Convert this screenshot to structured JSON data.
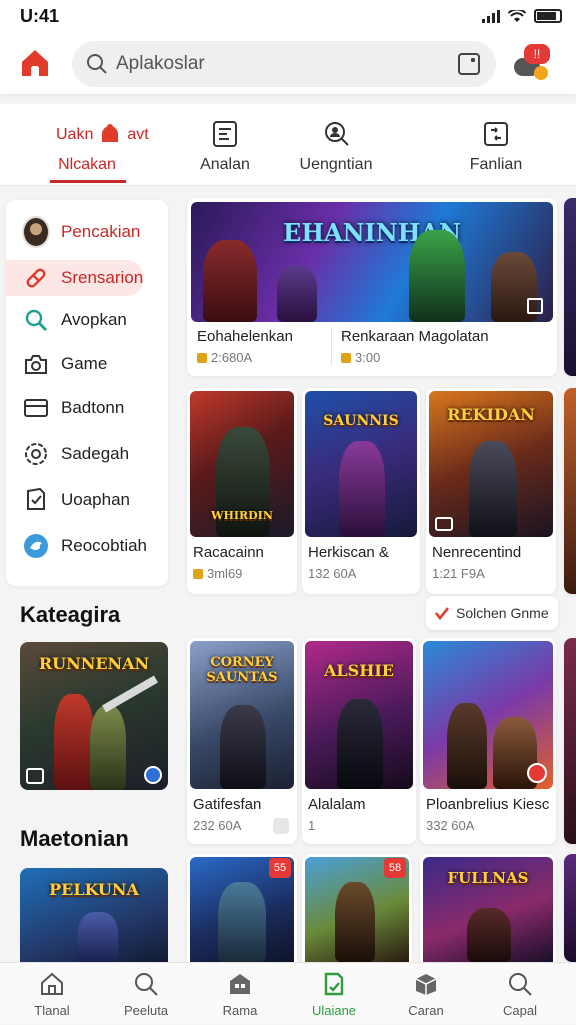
{
  "status": {
    "time": "U:41"
  },
  "search": {
    "placeholder": "Aplakoslar"
  },
  "notification": {
    "badge": "!!"
  },
  "tabs": [
    {
      "label": "Nlcakan",
      "top_label": "Uakn",
      "top_suffix": "avt",
      "active": true
    },
    {
      "label": "Analan"
    },
    {
      "label": "Uengntian"
    },
    {
      "label": "Fanlian"
    }
  ],
  "sidebar": {
    "items": [
      {
        "label": "Pencakian",
        "icon": "avatar"
      },
      {
        "label": "Srensarion",
        "icon": "pill-icon"
      },
      {
        "label": "Avopkan",
        "icon": "search-icon"
      },
      {
        "label": "Game",
        "icon": "camera-icon"
      },
      {
        "label": "Badtonn",
        "icon": "card-icon"
      },
      {
        "label": "Sadegah",
        "icon": "gear-chat-icon"
      },
      {
        "label": "Uoaphan",
        "icon": "check-shield-icon"
      },
      {
        "label": "Reocobtiah",
        "icon": "blue-bird-icon"
      }
    ]
  },
  "sections": {
    "kategori": "Kateagira",
    "mae": "Maetonian"
  },
  "side_cards": [
    {
      "title": "RUNNENAN"
    },
    {
      "title": "PELKUNA"
    }
  ],
  "featured": [
    {
      "title": "EHANINHAN",
      "name": "Eohahelenkan",
      "meta": "2:680A"
    },
    {
      "title": "",
      "name": "Renkaraan  Magolatan",
      "meta": "3:00"
    }
  ],
  "row1": [
    {
      "title": "WHIRDIN",
      "name": "Racacainn",
      "meta": "3ml69"
    },
    {
      "title": "SAUNNIS",
      "name": "Herkiscan &",
      "meta": "132 60A"
    },
    {
      "title": "REKIDAN",
      "name": "Nenrecentind",
      "meta": "1:21 F9A"
    }
  ],
  "pill": {
    "label": "Solchen Gnme"
  },
  "row2": [
    {
      "title": "CORNEY SAUNTAS",
      "name": "Gatifesfan",
      "meta": "232 60A"
    },
    {
      "title": "ALSHIE",
      "name": "Alalalam",
      "meta": "1"
    },
    {
      "title": "",
      "name": "Ploanbrelius Kiesc",
      "meta": "332 60A"
    }
  ],
  "row3": [
    {
      "title": "",
      "badge": "55"
    },
    {
      "title": "",
      "badge": "58"
    },
    {
      "title": "FULLNAS"
    }
  ],
  "bottom_nav": [
    {
      "label": "Tlanal"
    },
    {
      "label": "Peeluta"
    },
    {
      "label": "Rama"
    },
    {
      "label": "Ulaiane",
      "active": true
    },
    {
      "label": "Caran"
    },
    {
      "label": "Capal"
    }
  ],
  "colors": {
    "accent": "#c62828",
    "active_nav": "#2e9d3f",
    "badge": "#e53935"
  }
}
